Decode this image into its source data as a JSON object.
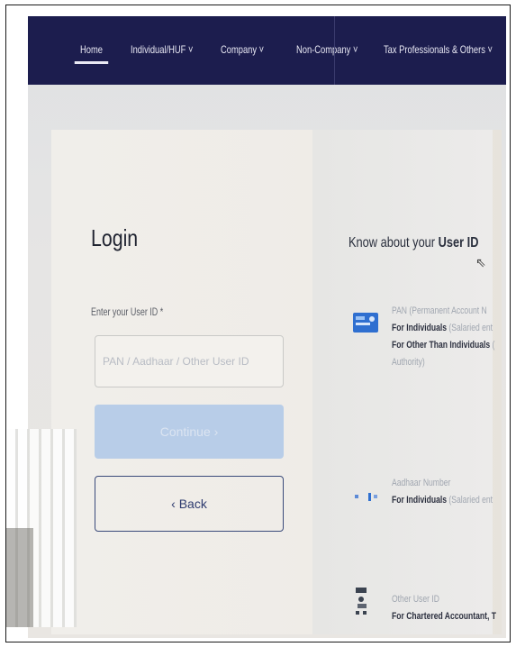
{
  "nav": {
    "items": [
      {
        "label": "Home",
        "active": true
      },
      {
        "label": "Individual/HUF ˅"
      },
      {
        "label": "Company ˅"
      },
      {
        "label": "Non-Company ˅"
      },
      {
        "label": "Tax Professionals & Others ˅"
      }
    ]
  },
  "login": {
    "title": "Login",
    "user_id_label": "Enter your User ID *",
    "user_id_placeholder": "PAN / Aadhaar / Other User ID",
    "user_id_value": "",
    "continue_label": "Continue ›",
    "back_label": "‹ Back"
  },
  "know": {
    "title_prefix": "Know about your",
    "title_emphasis": "User ID",
    "items": [
      {
        "icon": "pan-card-icon",
        "title": "PAN (Permanent Account N",
        "line1_strong": "For Individuals",
        "line1_rest": " (Salaried ent",
        "line2_strong": "For Other Than Individuals",
        "line2_rest": " (",
        "line3": "Authority)"
      },
      {
        "icon": "aadhaar-icon",
        "title": "Aadhaar Number",
        "line1_strong": "For Individuals",
        "line1_rest": " (Salaried ent"
      },
      {
        "icon": "other-user-icon",
        "title": "Other User ID",
        "line1_strong": "For Chartered Accountant, T",
        "line1_rest": ""
      }
    ]
  },
  "colors": {
    "nav_bg": "#1c1d4e",
    "continue_disabled": "#b8cde8",
    "back_border": "#3a4a7a"
  }
}
